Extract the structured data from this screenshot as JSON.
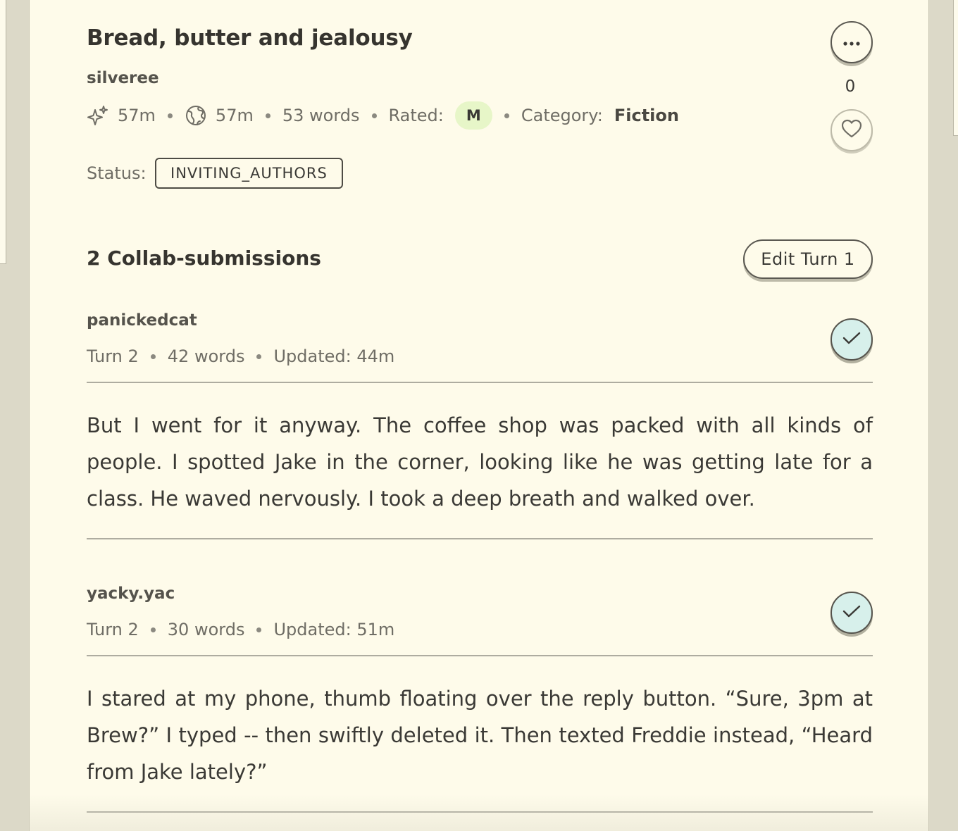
{
  "story": {
    "title": "Bread, butter and jealousy",
    "author": "silveree",
    "created_ago": "57m",
    "published_ago": "57m",
    "words": "53 words",
    "rated_label": "Rated:",
    "rating": "M",
    "category_label": "Category:",
    "category": "Fiction",
    "status_label": "Status:",
    "status": "INVITING_AUTHORS",
    "likes": "0"
  },
  "collab": {
    "heading": "2 Collab-submissions",
    "edit_button": "Edit Turn 1",
    "submissions": [
      {
        "author": "panickedcat",
        "turn": "Turn 2",
        "words": "42 words",
        "updated": "Updated: 44m",
        "text": "But I went for it anyway. The coffee shop was packed with all kinds of people. I spotted Jake in the corner, looking like he was getting late for a class. He waved nervously. I took a deep breath and walked over."
      },
      {
        "author": "yacky.yac",
        "turn": "Turn 2",
        "words": "30 words",
        "updated": "Updated: 51m",
        "text": "I stared at my phone, thumb floating over the reply button. “Sure, 3pm at Brew?” I typed -- then swiftly deleted it. Then texted Freddie instead, “Heard from Jake lately?”"
      }
    ]
  },
  "icons": {
    "more": "more-horizontal-icon",
    "like": "heart-icon",
    "created": "sparkle-icon",
    "published": "globe-icon",
    "approve": "check-icon"
  },
  "colors": {
    "card_bg": "#fefbea",
    "page_bg": "#dcd9c8",
    "rating_badge": "#e7f6c8",
    "check_bg": "#d7f0eb"
  }
}
